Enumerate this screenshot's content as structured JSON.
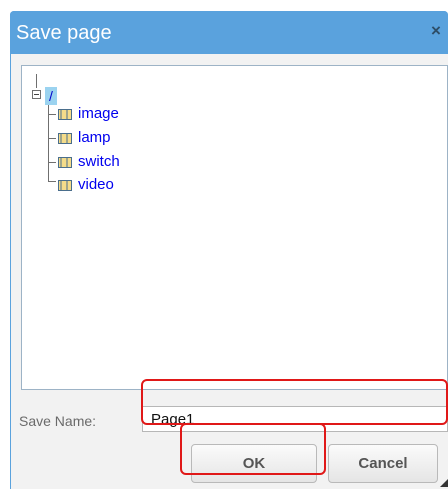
{
  "dialog": {
    "title": "Save page",
    "close_symbol": "×"
  },
  "tree": {
    "root_label": "/",
    "items": [
      {
        "label": "image",
        "icon": "folder-icon"
      },
      {
        "label": "lamp",
        "icon": "folder-icon"
      },
      {
        "label": "switch",
        "icon": "folder-icon"
      },
      {
        "label": "video",
        "icon": "folder-icon"
      }
    ]
  },
  "form": {
    "save_name_label": "Save Name:",
    "save_name_value": "Page1"
  },
  "buttons": {
    "ok_label": "OK",
    "cancel_label": "Cancel"
  },
  "colors": {
    "titlebar": "#5aa2dd",
    "highlight": "#e01818",
    "link": "#0000ee"
  }
}
